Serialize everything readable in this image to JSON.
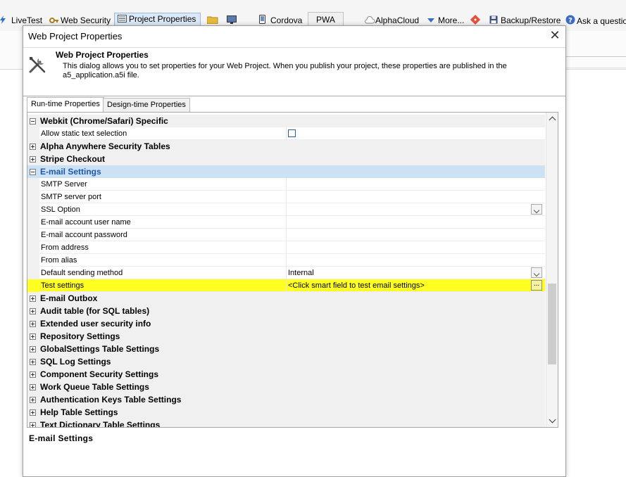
{
  "toolbar": {
    "items": [
      {
        "label": "LiveTest"
      },
      {
        "label": "Web Security"
      },
      {
        "label": "Project Properties"
      },
      {
        "label": "Cordova"
      },
      {
        "label": "PWA"
      },
      {
        "label": "AlphaCloud"
      },
      {
        "label": "More..."
      },
      {
        "label": "Backup/Restore"
      },
      {
        "label": "Ask a question"
      }
    ]
  },
  "dialog": {
    "title": "Web Project Properties",
    "header_title": "Web Project Properties",
    "header_desc": "This dialog allows you to set properties for your Web Project. When you publish your project, these properties are published in the a5_application.a5i file.",
    "tabs": [
      {
        "label": "Run-time Properties",
        "active": true
      },
      {
        "label": "Design-time Properties",
        "active": false
      }
    ],
    "grid": {
      "rows": [
        {
          "type": "category",
          "label": "Webkit (Chrome/Safari) Specific",
          "expanded": true
        },
        {
          "type": "property",
          "label": "Allow static text selection",
          "value": "",
          "control": "checkbox"
        },
        {
          "type": "category",
          "label": "Alpha Anywhere Security Tables",
          "expanded": false
        },
        {
          "type": "category",
          "label": "Stripe Checkout",
          "expanded": false
        },
        {
          "type": "category",
          "label": "E-mail Settings",
          "expanded": true,
          "selected": true
        },
        {
          "type": "property",
          "label": "SMTP Server",
          "value": ""
        },
        {
          "type": "property",
          "label": "SMTP server port",
          "value": ""
        },
        {
          "type": "property",
          "label": "SSL Option",
          "value": "",
          "control": "dropdown"
        },
        {
          "type": "property",
          "label": "E-mail account user name",
          "value": ""
        },
        {
          "type": "property",
          "label": "E-mail account password",
          "value": ""
        },
        {
          "type": "property",
          "label": "From address",
          "value": ""
        },
        {
          "type": "property",
          "label": "From alias",
          "value": ""
        },
        {
          "type": "property",
          "label": "Default sending method",
          "value": "Internal",
          "control": "dropdown"
        },
        {
          "type": "property",
          "label": "Test settings",
          "value": "<Click smart field to test email settings>",
          "control": "ellipsis",
          "highlight": true
        },
        {
          "type": "category",
          "label": "E-mail Outbox",
          "expanded": false
        },
        {
          "type": "category",
          "label": "Audit table (for SQL tables)",
          "expanded": false
        },
        {
          "type": "category",
          "label": "Extended user security info",
          "expanded": false
        },
        {
          "type": "category",
          "label": "Repository Settings",
          "expanded": false
        },
        {
          "type": "category",
          "label": "GlobalSettings Table Settings",
          "expanded": false
        },
        {
          "type": "category",
          "label": "SQL Log Settings",
          "expanded": false
        },
        {
          "type": "category",
          "label": "Component Security Settings",
          "expanded": false
        },
        {
          "type": "category",
          "label": "Work Queue Table Settings",
          "expanded": false
        },
        {
          "type": "category",
          "label": "Authentication Keys Table Settings",
          "expanded": false
        },
        {
          "type": "category",
          "label": "Help Table Settings",
          "expanded": false
        },
        {
          "type": "category",
          "label": "Text Dictionary Table Settings",
          "expanded": false
        }
      ]
    },
    "description_title": "E-mail Settings"
  }
}
